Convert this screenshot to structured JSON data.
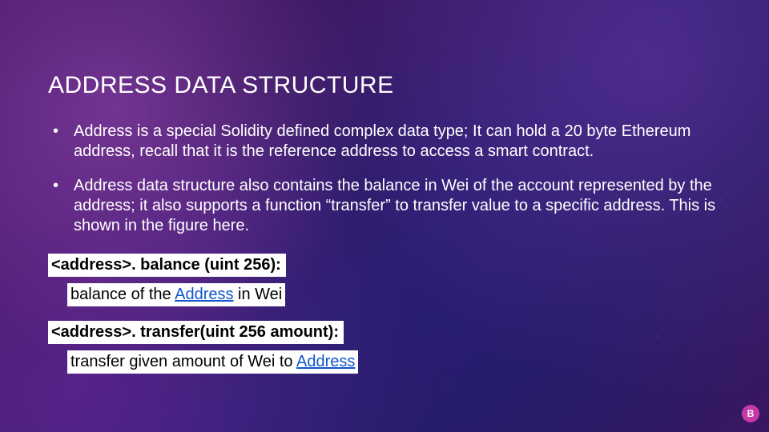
{
  "title": "ADDRESS DATA STRUCTURE",
  "bullets": [
    "Address is a special Solidity defined complex data type; It can hold a  20 byte Ethereum address, recall that it is the reference address to access a smart contract.",
    "Address data structure also contains the balance in Wei of the account represented by the address; it also supports a function “transfer” to transfer value to a specific address.  This is shown in the figure here."
  ],
  "code1": {
    "signature": "<address>. balance (uint 256):",
    "desc_prefix": "balance of the ",
    "desc_link": "Address",
    "desc_suffix": " in Wei"
  },
  "code2": {
    "signature": "<address>. transfer(uint 256 amount):",
    "desc_prefix": "transfer given amount of Wei to ",
    "desc_link": "Address",
    "desc_suffix": ""
  },
  "badge": "B"
}
